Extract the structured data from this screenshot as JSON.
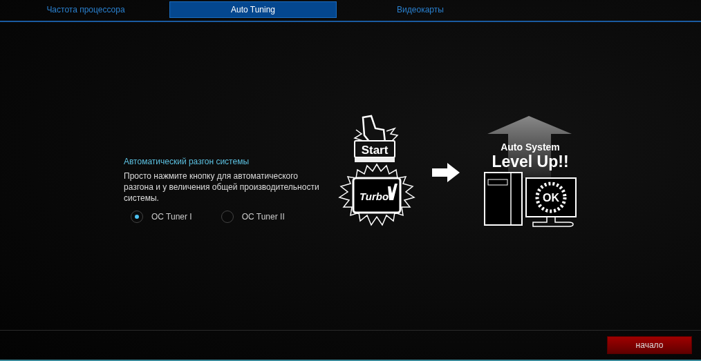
{
  "tabs": [
    {
      "label": "Частота процессора",
      "selected": false
    },
    {
      "label": "Auto Tuning",
      "selected": true
    },
    {
      "label": "Видеокарты",
      "selected": false
    }
  ],
  "panel": {
    "heading": "Автоматический разгон системы",
    "description": "Просто нажмите кнопку для автоматического разгона и у величения общей производительности системы.",
    "options": [
      {
        "label": "OC Tuner I",
        "selected": true
      },
      {
        "label": "OC Tuner II",
        "selected": false
      }
    ]
  },
  "illustration": {
    "start_label": "Start",
    "chip_label": "Turbo",
    "headline_top": "Auto System",
    "headline_bottom": "Level Up!!",
    "screen_label": "OK"
  },
  "footer": {
    "button": "начало"
  }
}
